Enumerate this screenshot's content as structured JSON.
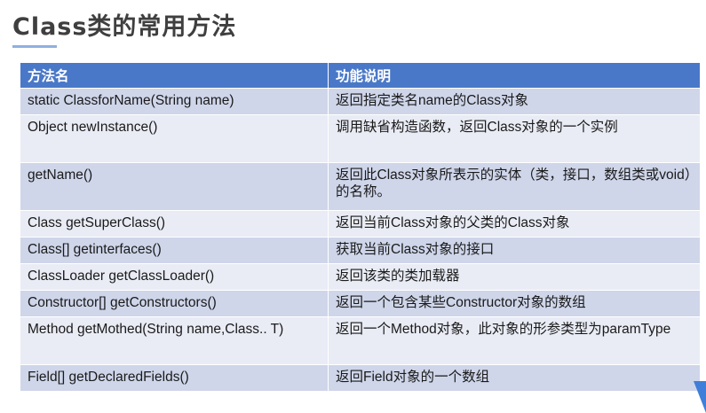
{
  "title": "Class类的常用方法",
  "table": {
    "headers": [
      "方法名",
      "功能说明"
    ],
    "rows": [
      [
        "static ClassforName(String name)",
        "返回指定类名name的Class对象"
      ],
      [
        "Object newInstance()",
        "调用缺省构造函数，返回Class对象的一个实例"
      ],
      [
        "getName()",
        "返回此Class对象所表示的实体（类，接口，数组类或void）的名称。"
      ],
      [
        "Class getSuperClass()",
        "返回当前Class对象的父类的Class对象"
      ],
      [
        "Class[] getinterfaces()",
        "获取当前Class对象的接口"
      ],
      [
        "ClassLoader getClassLoader()",
        "返回该类的类加载器"
      ],
      [
        "Constructor[] getConstructors()",
        "返回一个包含某些Constructor对象的数组"
      ],
      [
        "Method getMothed(String name,Class.. T)",
        "返回一个Method对象，此对象的形参类型为paramType"
      ],
      [
        "Field[] getDeclaredFields()",
        "返回Field对象的一个数组"
      ]
    ]
  },
  "colors": {
    "header_bg": "#4a78c8",
    "row_odd_bg": "#cfd6ea",
    "row_even_bg": "#e9ecf5",
    "accent": "#3f7fd9"
  }
}
